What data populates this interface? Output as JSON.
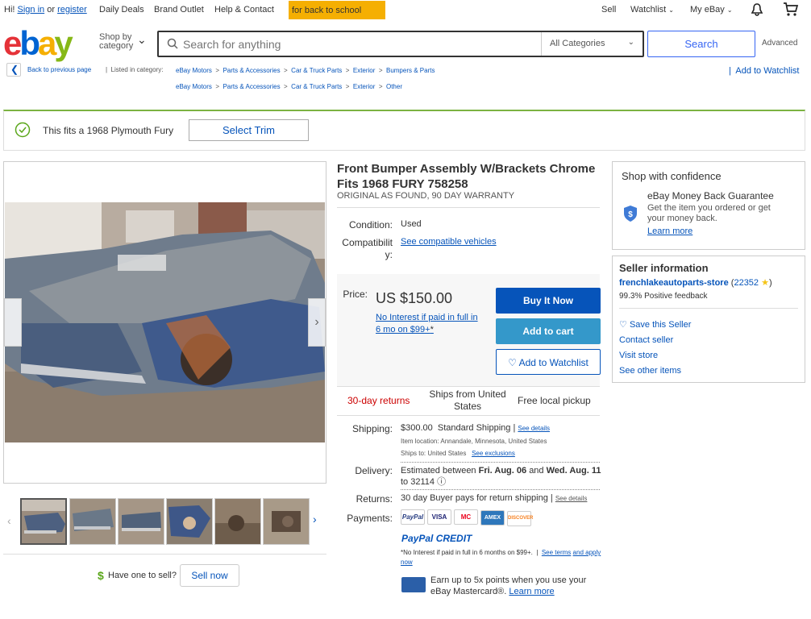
{
  "topnav": {
    "greeting": "Hi!",
    "signin": "Sign in",
    "or": "or",
    "register": "register",
    "daily_deals": "Daily Deals",
    "brand_outlet": "Brand Outlet",
    "help": "Help & Contact",
    "promo": "for back to school",
    "sell": "Sell",
    "watchlist": "Watchlist",
    "myebay": "My eBay"
  },
  "header": {
    "shop_by_1": "Shop by",
    "shop_by_2": "category",
    "search_placeholder": "Search for anything",
    "category": "All Categories",
    "search_button": "Search",
    "advanced": "Advanced"
  },
  "breadcrumbs": {
    "back": "Back to previous page",
    "listed_in": "Listed in category:",
    "row1": [
      "eBay Motors",
      "Parts & Accessories",
      "Car & Truck Parts",
      "Exterior",
      "Bumpers & Parts"
    ],
    "row2": [
      "eBay Motors",
      "Parts & Accessories",
      "Car & Truck Parts",
      "Exterior",
      "Other"
    ],
    "add_watchlist": "Add to Watchlist"
  },
  "fitment": {
    "text": "This fits a 1968 Plymouth Fury",
    "button": "Select Trim"
  },
  "listing": {
    "title": "Front Bumper Assembly W/Brackets Chrome Fits 1968 FURY 758258",
    "subtitle": "ORIGINAL AS FOUND, 90 DAY WARRANTY",
    "condition_label": "Condition:",
    "condition": "Used",
    "compat_label_1": "Compatibilit",
    "compat_label_2": "y:",
    "compat_link": "See compatible vehicles",
    "price_label": "Price:",
    "price": "US $150.00",
    "finance_1": "No Interest if paid in full in",
    "finance_2": "6 mo on $99+",
    "finance_star": "*",
    "buy_now": "Buy It Now",
    "add_cart": "Add to cart",
    "add_watchlist": "Add to Watchlist",
    "returns_badge": "30-day returns",
    "ships_from_1": "Ships from United",
    "ships_from_2": "States",
    "local_pickup": "Free local pickup",
    "shipping_label": "Shipping:",
    "shipping_cost": "$300.00",
    "shipping_type": "Standard Shipping",
    "see_details": "See details",
    "item_location": "Item location:  Annandale, Minnesota, United States",
    "ships_to": "Ships to:  United States",
    "see_exclusions": "See exclusions",
    "delivery_label": "Delivery:",
    "delivery_pre": "Estimated between",
    "delivery_d1": "Fri. Aug. 06",
    "delivery_and": "and",
    "delivery_d2": "Wed. Aug. 11",
    "delivery_to": "to 32114",
    "returns_label": "Returns:",
    "returns_text": "30 day Buyer pays for return shipping",
    "returns_details": "See details",
    "payments_label": "Payments:",
    "pay_badges": [
      "PayPal",
      "VISA",
      "MC",
      "AMEX",
      "DISCOVER"
    ],
    "paypal_credit": "PayPal CREDIT",
    "credit_note": "*No Interest if paid in full in 6 months on $99+.",
    "see_terms": "See terms",
    "and_apply": "and apply now",
    "mastercard_1": "Earn up to 5x points when you use your",
    "mastercard_2": "eBay Mastercard®.",
    "learn_more": "Learn more"
  },
  "gallery": {
    "sell_prompt": "Have one to sell?",
    "sell_now": "Sell now"
  },
  "confidence": {
    "title": "Shop with confidence",
    "guarantee": "eBay Money Back Guarantee",
    "desc_1": "Get the item you ordered or get",
    "desc_2": "your money back.",
    "learn_more": "Learn more"
  },
  "seller": {
    "title": "Seller information",
    "name": "frenchlakeautoparts-store",
    "feedback_count": "22352",
    "positive": "99.3% Positive feedback",
    "save": "Save this Seller",
    "contact": "Contact seller",
    "visit": "Visit store",
    "other": "See other items"
  },
  "colors": {
    "ebay_blue": "#0654ba",
    "buy_now": "#0654ba",
    "add_cart": "#3498ca",
    "fitment_green": "#7cb342"
  }
}
